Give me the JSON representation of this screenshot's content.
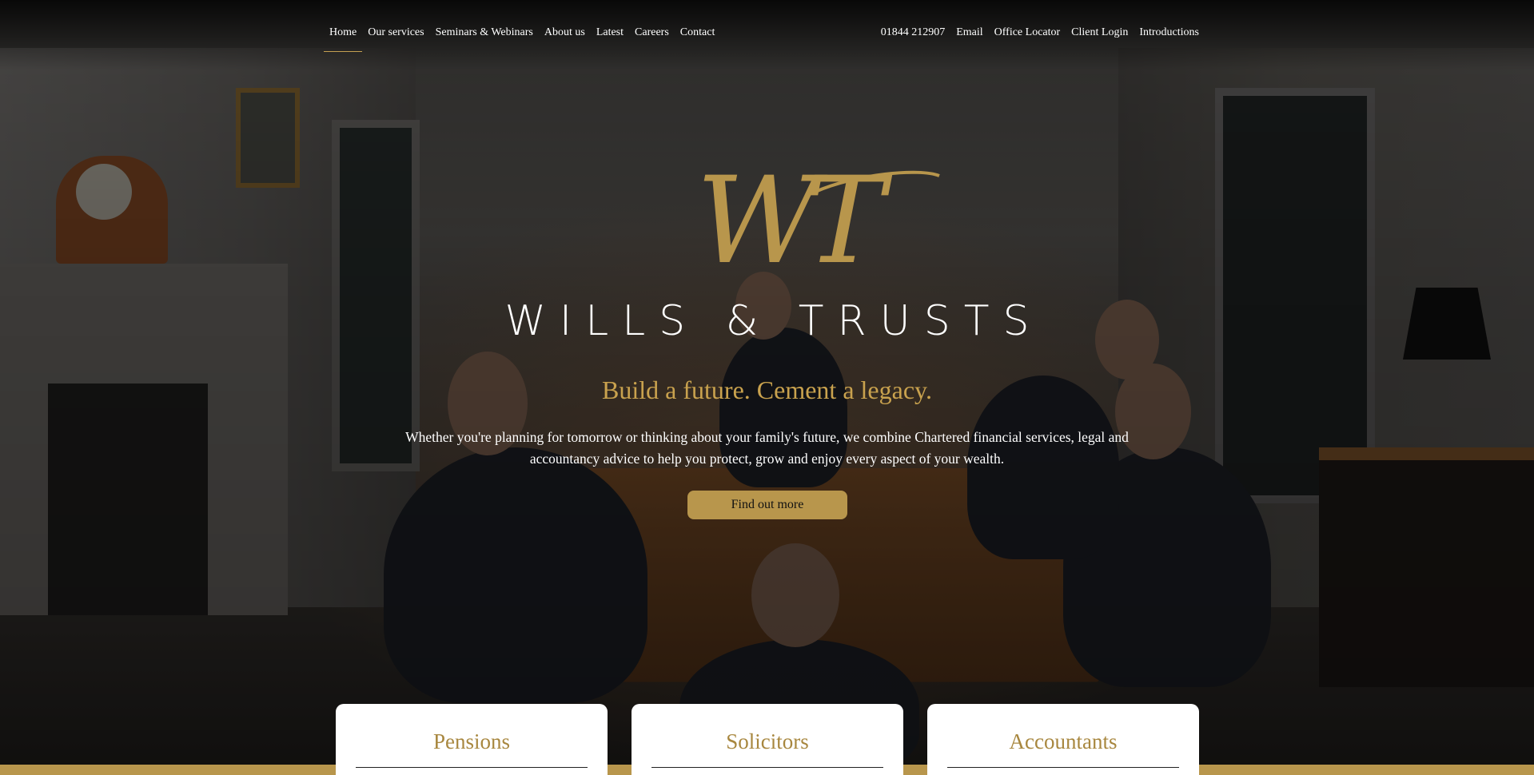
{
  "nav": {
    "left": [
      {
        "label": "Home",
        "active": true
      },
      {
        "label": "Our services"
      },
      {
        "label": "Seminars & Webinars"
      },
      {
        "label": "About us"
      },
      {
        "label": "Latest"
      },
      {
        "label": "Careers"
      },
      {
        "label": "Contact"
      }
    ],
    "right": [
      {
        "label": "01844 212907"
      },
      {
        "label": "Email"
      },
      {
        "label": "Office Locator"
      },
      {
        "label": "Client Login"
      },
      {
        "label": "Introductions"
      }
    ]
  },
  "hero": {
    "logo_monogram": "WT",
    "brand_name": "WILLS & TRUSTS",
    "tagline": "Build a future. Cement a legacy.",
    "intro": "Whether you're planning for tomorrow or thinking about your family's future, we combine Chartered financial services, legal and accountancy advice to help you protect, grow and enjoy every aspect of your wealth.",
    "cta_label": "Find out more"
  },
  "cards": [
    {
      "title": "Pensions"
    },
    {
      "title": "Solicitors"
    },
    {
      "title": "Accountants"
    }
  ],
  "colors": {
    "gold": "#b8964c",
    "gold_text": "#c9a24e",
    "card_title": "#a8873f"
  }
}
